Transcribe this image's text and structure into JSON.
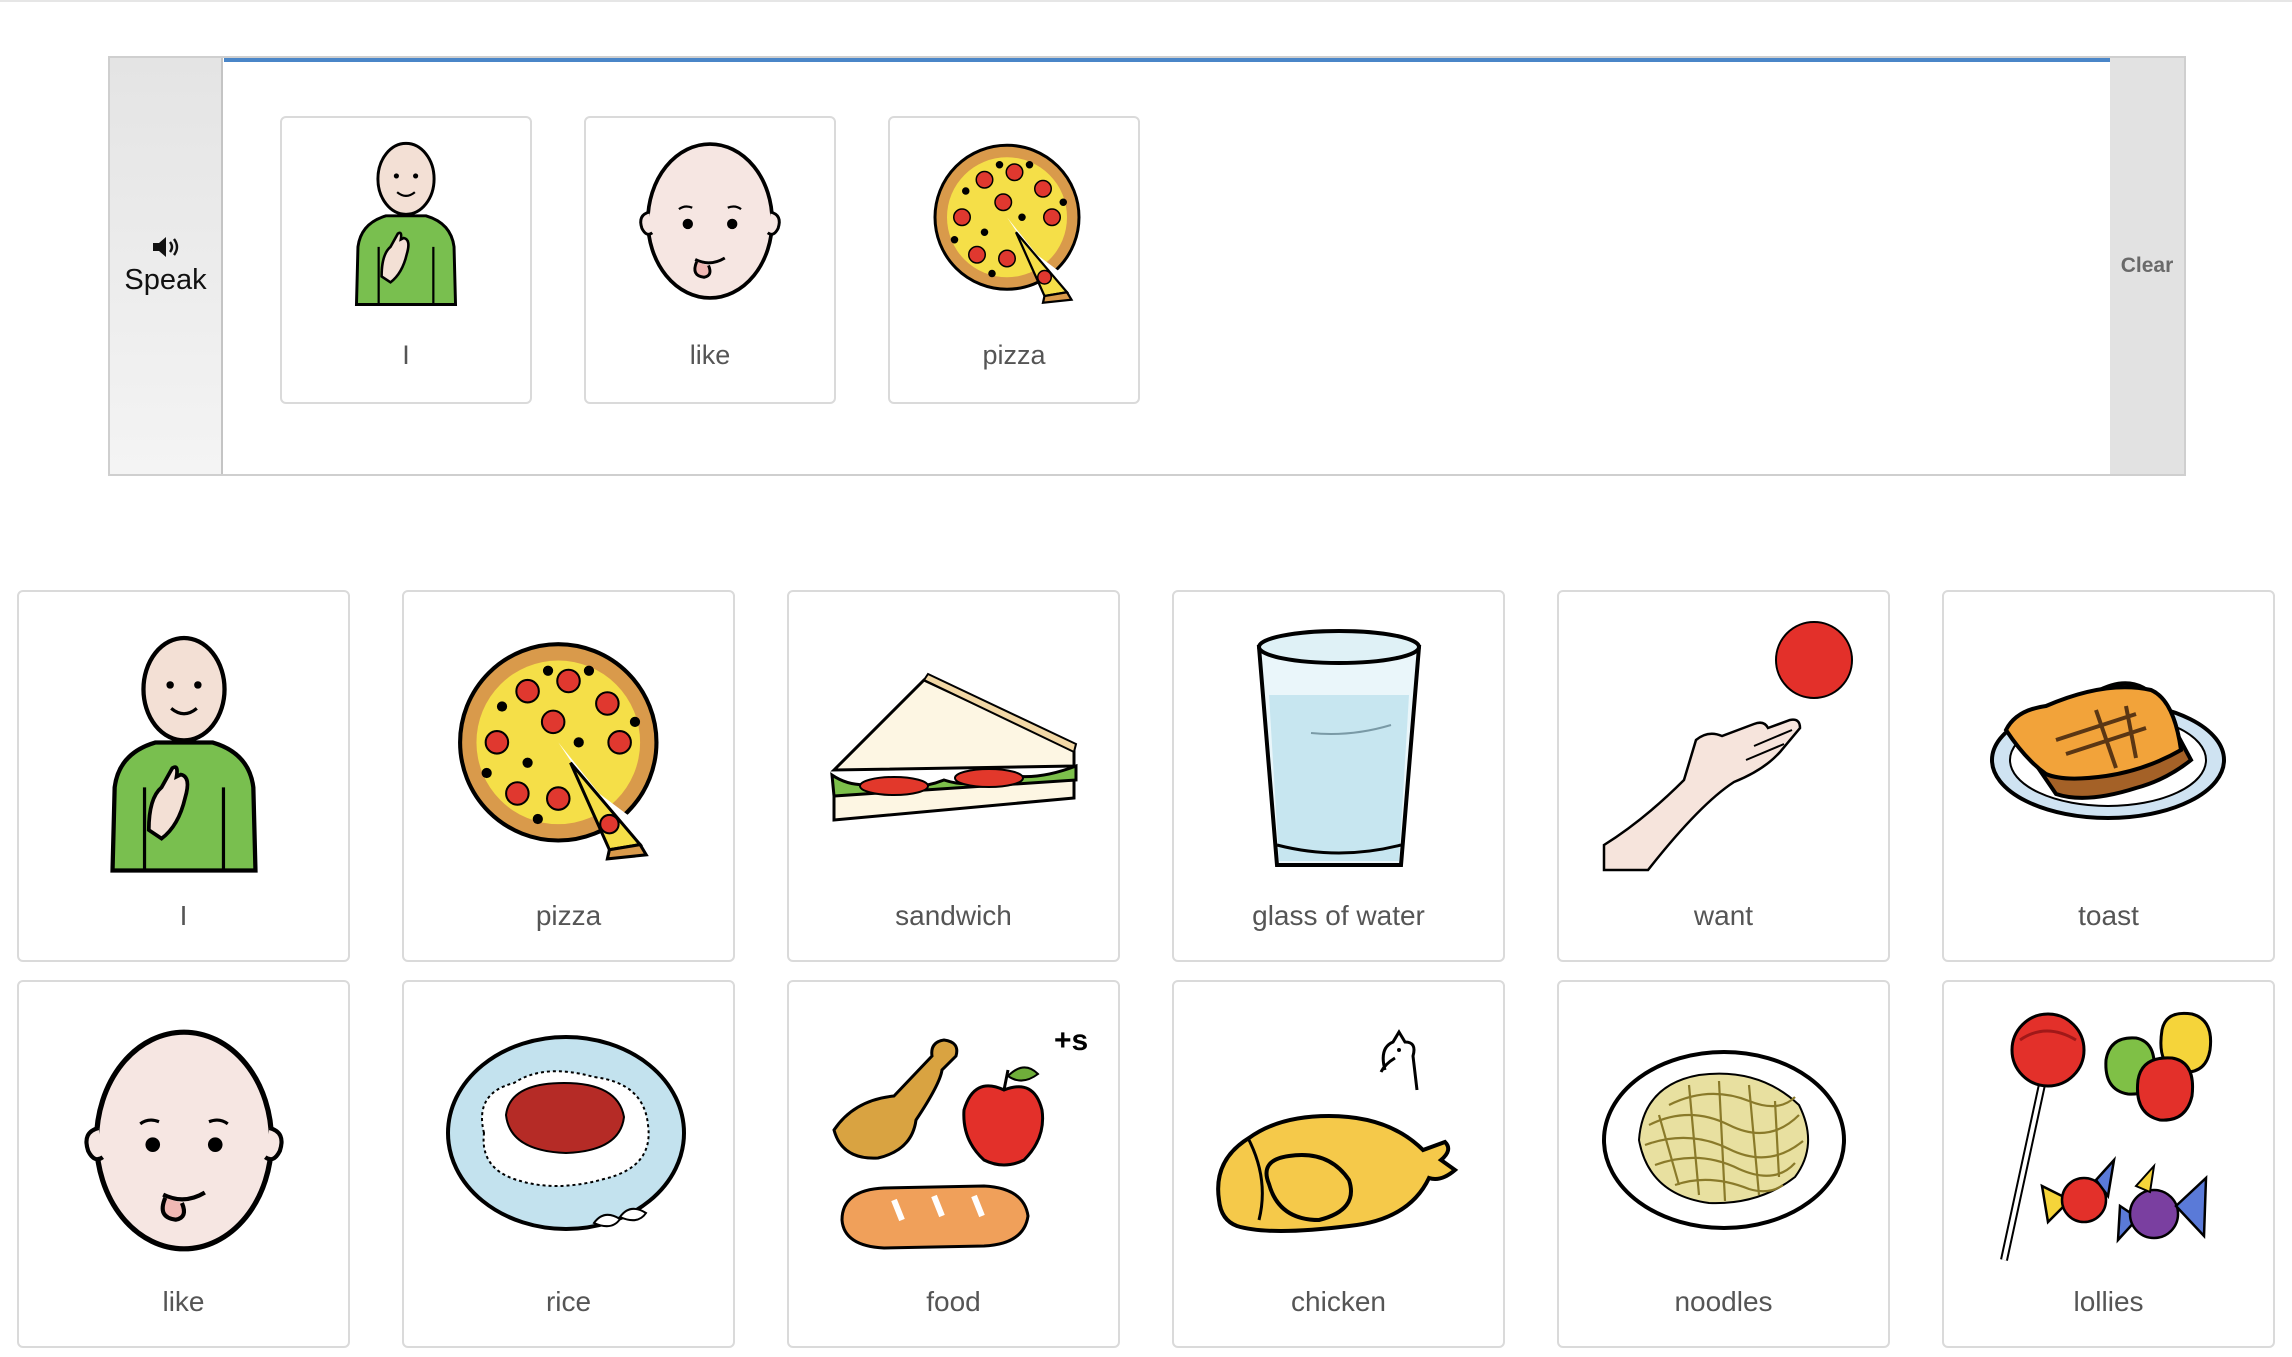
{
  "sentence_bar": {
    "speak_label": "Speak",
    "speak_icon": "speaker-icon",
    "clear_label": "Clear",
    "words": [
      {
        "label": "I",
        "icon": "person-pointing-self-icon"
      },
      {
        "label": "like",
        "icon": "face-licking-lips-icon"
      },
      {
        "label": "pizza",
        "icon": "pizza-icon"
      }
    ]
  },
  "grid": {
    "row1": [
      {
        "label": "I",
        "icon": "person-pointing-self-icon"
      },
      {
        "label": "pizza",
        "icon": "pizza-icon"
      },
      {
        "label": "sandwich",
        "icon": "sandwich-icon"
      },
      {
        "label": "glass of water",
        "icon": "glass-of-water-icon"
      },
      {
        "label": "want",
        "icon": "hand-reaching-ball-icon"
      },
      {
        "label": "toast",
        "icon": "toast-icon"
      }
    ],
    "row2": [
      {
        "label": "like",
        "icon": "face-licking-lips-icon"
      },
      {
        "label": "rice",
        "icon": "rice-plate-icon"
      },
      {
        "label": "food",
        "icon": "food-group-icon"
      },
      {
        "label": "chicken",
        "icon": "roast-chicken-icon"
      },
      {
        "label": "noodles",
        "icon": "noodles-icon"
      },
      {
        "label": "lollies",
        "icon": "lollies-icon"
      }
    ]
  },
  "colors": {
    "accent": "#4a86c8",
    "card_border": "#dadada",
    "label_text": "#555555"
  }
}
